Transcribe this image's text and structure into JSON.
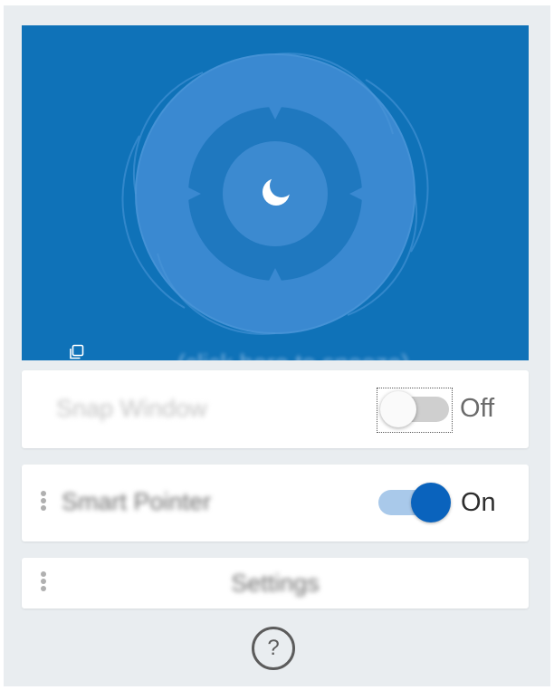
{
  "hero": {
    "snooze_link": "(click here to snooze)",
    "background_color": "#0f72b8",
    "center_icon": "moon-icon",
    "corner_icon": "copy-window-icon"
  },
  "snap_window": {
    "label": "Snap Window",
    "state": "Off",
    "enabled": false
  },
  "smart_pointer": {
    "label": "Smart Pointer",
    "state": "On",
    "enabled": true
  },
  "settings": {
    "label": "Settings"
  },
  "help": {
    "label": "?"
  },
  "colors": {
    "accent": "#0a63bd",
    "accent_track": "#a9c9ea",
    "panel": "#e9edf0"
  }
}
